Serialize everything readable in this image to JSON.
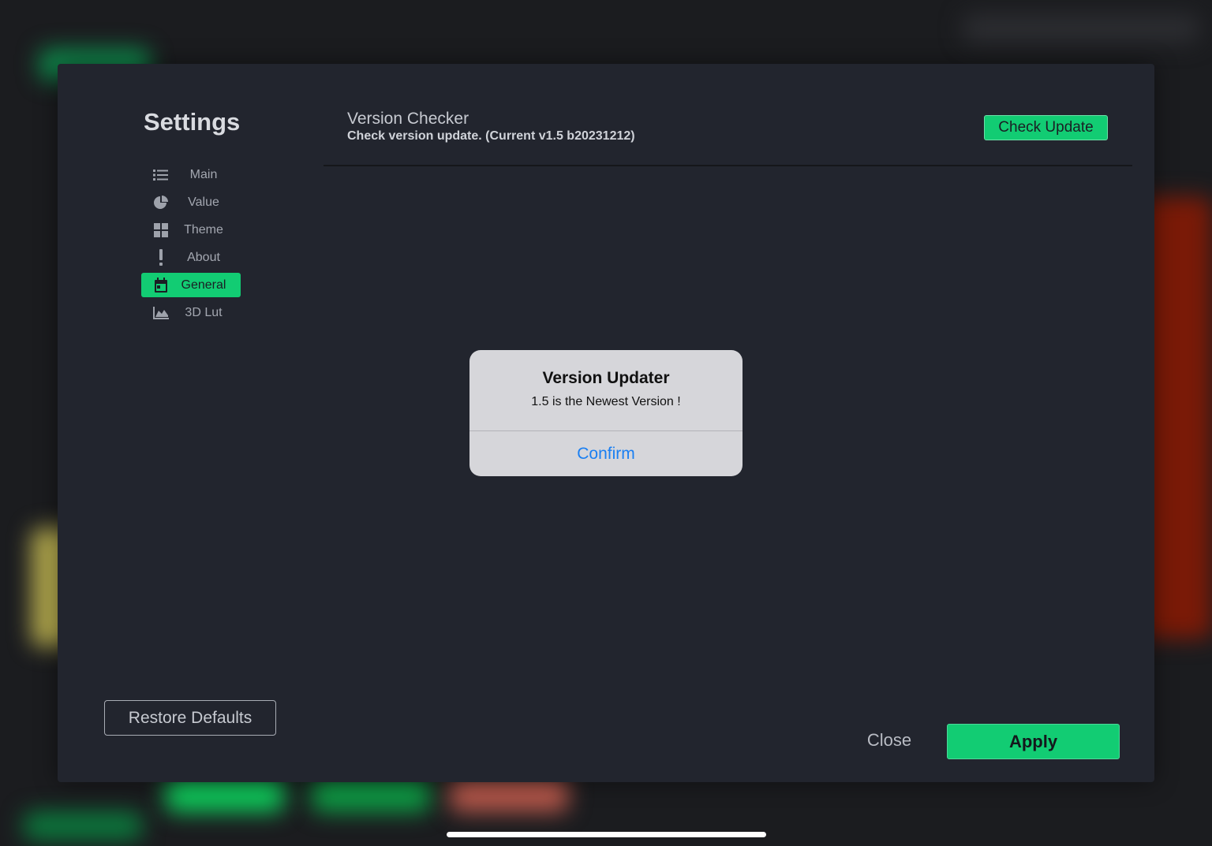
{
  "settings": {
    "title": "Settings",
    "nav": [
      {
        "label": "Main",
        "icon": "list-icon",
        "active": false
      },
      {
        "label": "Value",
        "icon": "pie-chart-icon",
        "active": false
      },
      {
        "label": "Theme",
        "icon": "grid-icon",
        "active": false
      },
      {
        "label": "About",
        "icon": "exclamation-icon",
        "active": false
      },
      {
        "label": "General",
        "icon": "calendar-icon",
        "active": true
      },
      {
        "label": "3D Lut",
        "icon": "area-chart-icon",
        "active": false
      }
    ],
    "restore_label": "Restore Defaults"
  },
  "version_checker": {
    "title": "Version Checker",
    "subtitle": "Check version update. (Current v1.5 b20231212)",
    "button_label": "Check Update"
  },
  "footer": {
    "close_label": "Close",
    "apply_label": "Apply"
  },
  "alert": {
    "title": "Version Updater",
    "message": "1.5 is the Newest Version !",
    "confirm_label": "Confirm"
  },
  "colors": {
    "accent": "#12cc73",
    "panel": "#22252e",
    "link": "#1a7ff2"
  }
}
